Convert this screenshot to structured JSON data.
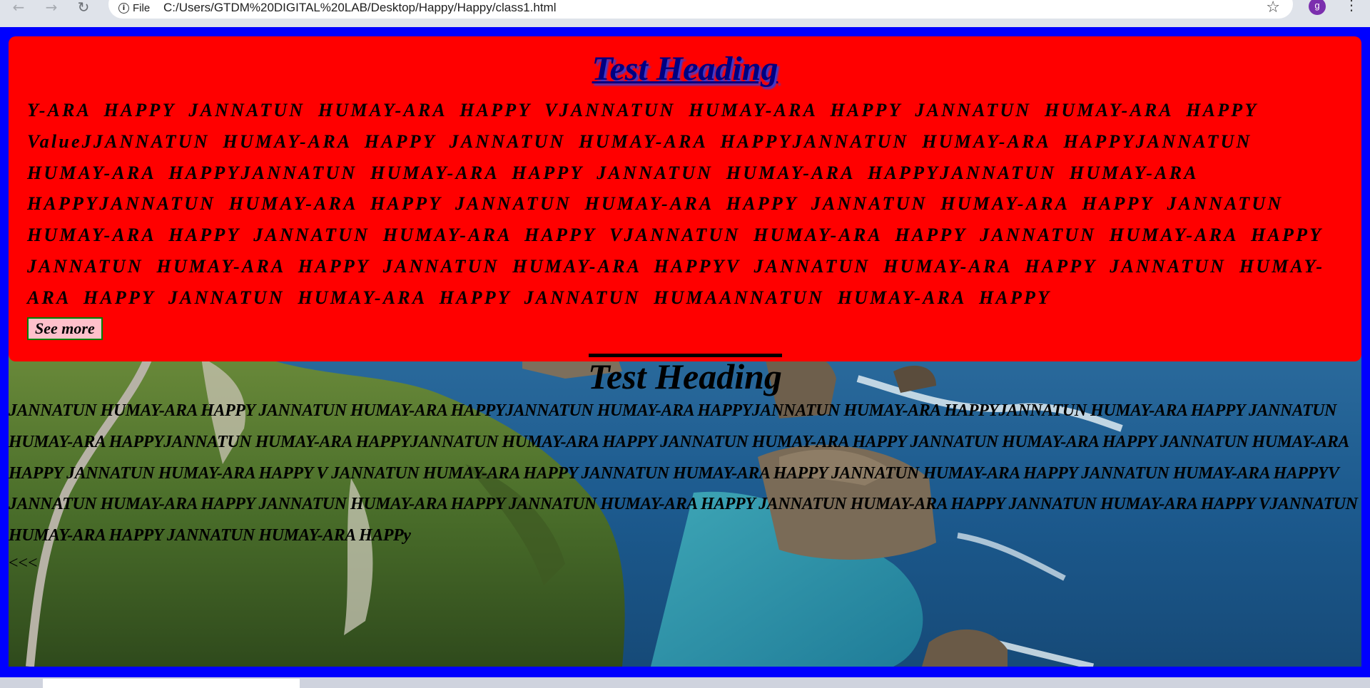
{
  "browser": {
    "site_info_label": "File",
    "url": "C:/Users/GTDM%20DIGITAL%20LAB/Desktop/Happy/Happy/class1.html",
    "avatar_letter": "g",
    "icons": {
      "back": "arrow-left-icon",
      "forward": "arrow-right-icon",
      "reload": "reload-icon",
      "site_info": "info-icon",
      "bookmark": "star-icon",
      "menu": "kebab-menu-icon"
    }
  },
  "page": {
    "colors": {
      "frame": "#0000ff",
      "card": "#ff0000",
      "heading": "#000080",
      "button_bg": "#ffc0cb",
      "button_border": "#008000"
    },
    "card": {
      "heading": "Test Heading",
      "paragraph": "Y-ARA HAPPY JANNATUN HUMAY-ARA HAPPY VJANNATUN HUMAY-ARA HAPPY JANNATUN HUMAY-ARA HAPPY ValueJJANNATUN HUMAY-ARA HAPPY JANNATUN HUMAY-ARA HAPPYJANNATUN HUMAY-ARA HAPPYJANNATUN HUMAY-ARA HAPPYJANNATUN HUMAY-ARA HAPPY JANNATUN HUMAY-ARA HAPPYJANNATUN HUMAY-ARA HAPPYJANNATUN HUMAY-ARA HAPPY JANNATUN HUMAY-ARA HAPPY JANNATUN HUMAY-ARA HAPPY JANNATUN HUMAY-ARA HAPPY JANNATUN HUMAY-ARA HAPPY VJANNATUN HUMAY-ARA HAPPY JANNATUN HUMAY-ARA HAPPY JANNATUN HUMAY-ARA HAPPY JANNATUN HUMAY-ARA HAPPYV JANNATUN HUMAY-ARA HAPPY JANNATUN HUMAY-ARA HAPPY JANNATUN HUMAY-ARA HAPPY JANNATUN HUMAANNATUN HUMAY-ARA HAPPY",
      "button_label": "See more"
    },
    "photo_section": {
      "heading": "Test Heading",
      "paragraph": "JANNATUN HUMAY-ARA HAPPY JANNATUN HUMAY-ARA HAPPYJANNATUN HUMAY-ARA HAPPYJANNATUN HUMAY-ARA HAPPYJANNATUN HUMAY-ARA HAPPY JANNATUN HUMAY-ARA HAPPYJANNATUN HUMAY-ARA HAPPYJANNATUN HUMAY-ARA HAPPY JANNATUN HUMAY-ARA HAPPY JANNATUN HUMAY-ARA HAPPY JANNATUN HUMAY-ARA HAPPY JANNATUN HUMAY-ARA HAPPY V JANNATUN HUMAY-ARA HAPPY JANNATUN HUMAY-ARA HAPPY JANNATUN HUMAY-ARA HAPPY JANNATUN HUMAY-ARA HAPPYV JANNATUN HUMAY-ARA HAPPY JANNATUN HUMAY-ARA HAPPY JANNATUN HUMAY-ARA HAPPY JANNATUN HUMAY-ARA HAPPY JANNATUN HUMAY-ARA HAPPY VJANNATUN HUMAY-ARA HAPPY JANNATUN HUMAY-ARA HAPPy",
      "back_link": "<<<"
    }
  }
}
